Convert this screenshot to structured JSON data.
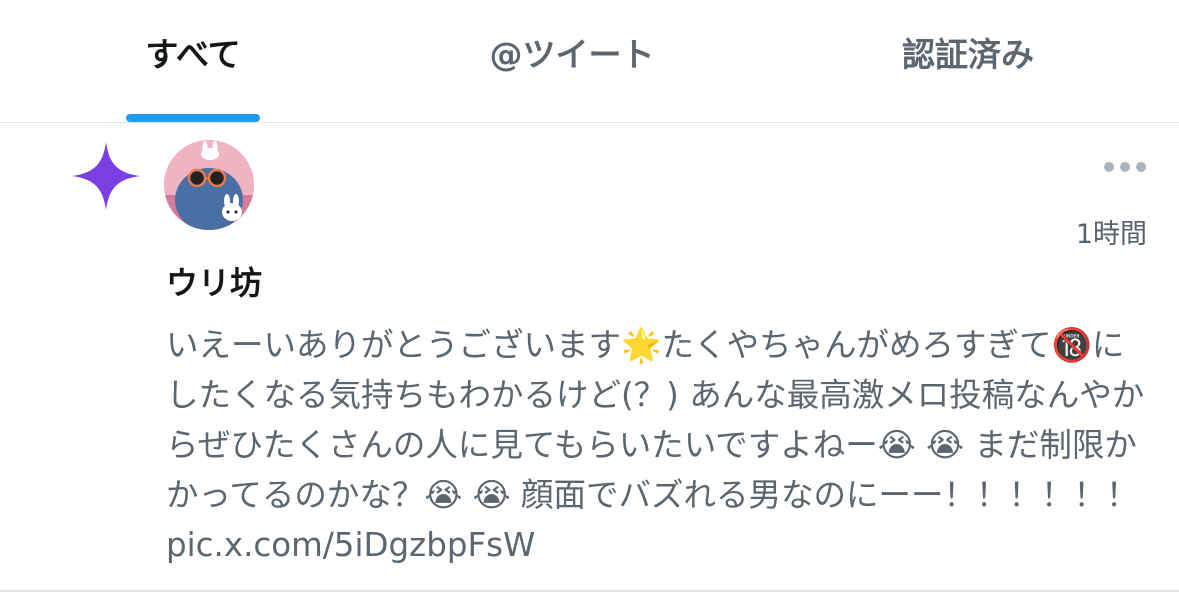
{
  "tabs": [
    {
      "label": "すべて",
      "active": true
    },
    {
      "label": "@ツイート",
      "active": false
    },
    {
      "label": "認証済み",
      "active": false
    }
  ],
  "colors": {
    "accent": "#1d9bf0",
    "sparkle": "#7b3fe4",
    "secondary_text": "#5b6670",
    "primary_text": "#14171a"
  },
  "notification": {
    "type_icon": "sparkle-icon",
    "avatar": "avatar-cat-with-sunglasses",
    "menu_icon": "more-dots-icon",
    "time": "1時間",
    "user_name": "ウリ坊",
    "tweet_text": "いえーいありがとうございます🌟たくやちゃんがめろすぎて🔞にしたくなる気持ちもわかるけど(？) あんな最高激メロ投稿なんやからぜひたくさんの人に見てもらいたいですよねー😭 😭 まだ制限かかってるのかな？😭 😭 顔面でバズれる男なのにーー！！！！！！ pic.x.com/5iDgzbpFsW"
  }
}
